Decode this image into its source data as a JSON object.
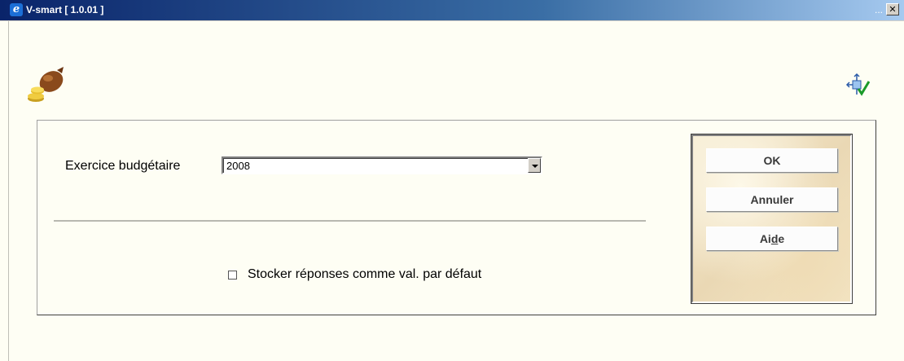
{
  "window": {
    "title": "V-smart [ 1.0.01 ]",
    "title_dots": "...",
    "close_glyph": "✕"
  },
  "icons": {
    "app": "ie-icon",
    "header": "money-bag-icon",
    "layout": "layout-check-icon"
  },
  "form": {
    "fiscal_year_label": "Exercice budgétaire",
    "fiscal_year_value": "2008",
    "store_defaults_label": "Stocker réponses comme val. par défaut",
    "store_defaults_checked": false
  },
  "buttons": {
    "ok": "OK",
    "cancel": "Annuler",
    "help_pre": "Ai",
    "help_underline": "d",
    "help_post": "e"
  },
  "colors": {
    "title_start": "#0a246a",
    "title_end": "#a6caf0",
    "background": "#fefef4",
    "button_text": "#3a3a3a"
  }
}
